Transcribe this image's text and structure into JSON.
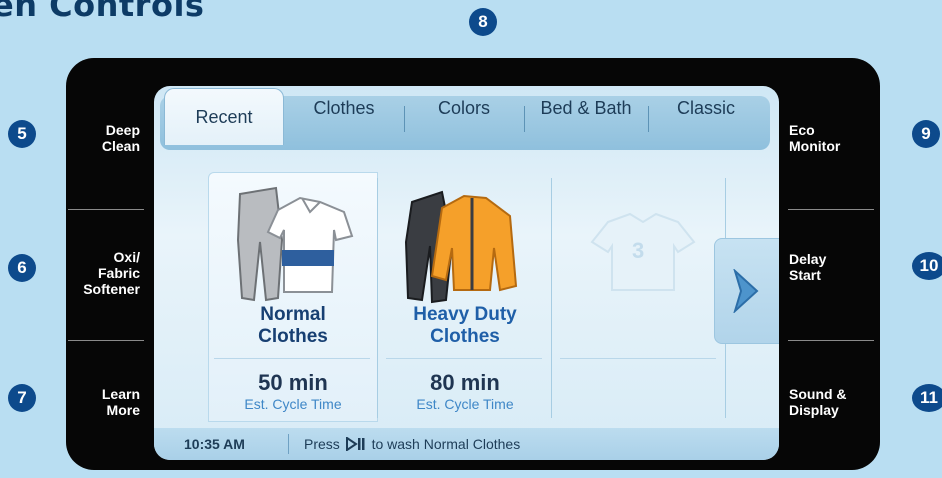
{
  "heading": "en Controls",
  "callouts": {
    "n5": "5",
    "n6": "6",
    "n7": "7",
    "n8": "8",
    "n9": "9",
    "n10": "10",
    "n11": "11"
  },
  "left_buttons": {
    "deep_clean": [
      "Deep",
      "Clean"
    ],
    "oxi": [
      "Oxi/",
      "Fabric",
      "Softener"
    ],
    "learn": [
      "Learn",
      "More"
    ]
  },
  "right_buttons": {
    "eco": [
      "Eco",
      "Monitor"
    ],
    "delay": [
      "Delay",
      "Start"
    ],
    "sound": [
      "Sound &",
      "Display"
    ]
  },
  "tabs": [
    {
      "label": "Recent",
      "active": true
    },
    {
      "label": "Clothes",
      "active": false
    },
    {
      "label": "Colors",
      "active": false
    },
    {
      "label": "Bed & Bath",
      "active": false
    },
    {
      "label": "Classic",
      "active": false
    }
  ],
  "cycles": [
    {
      "name": [
        "Normal",
        "Clothes"
      ],
      "time": "50 min",
      "est": "Est. Cycle Time",
      "selected": true
    },
    {
      "name": [
        "Heavy Duty",
        "Clothes"
      ],
      "time": "80 min",
      "est": "Est. Cycle Time",
      "selected": false
    },
    {
      "placeholder": "3"
    }
  ],
  "status": {
    "time": "10:35 AM",
    "msg_pre": "Press",
    "msg_post": "to wash Normal Clothes"
  },
  "icons": {
    "play_pause": "play-pause-icon",
    "next": "chevron-right-icon"
  },
  "colors": {
    "background": "#b9def2",
    "bezel": "#060606",
    "callout": "#0d4a8c",
    "accent_text": "#1f5fa8",
    "orange_jacket": "#f5a02a"
  }
}
